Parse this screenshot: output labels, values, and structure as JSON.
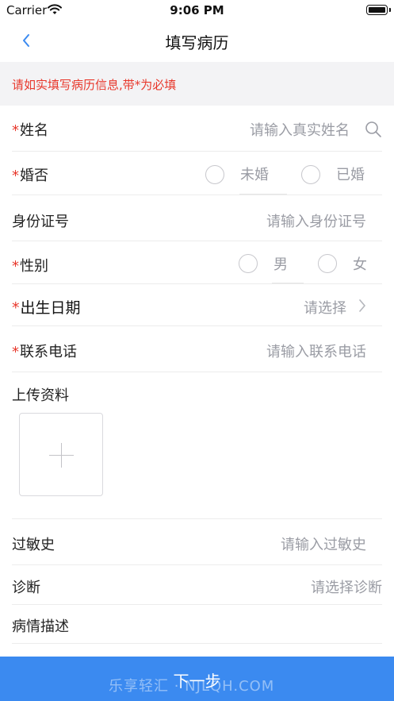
{
  "status_bar": {
    "carrier": "Carrier",
    "time": "9:06 PM"
  },
  "nav": {
    "title": "填写病历"
  },
  "notice": {
    "text": "请如实填写病历信息,带*为必填"
  },
  "form": {
    "required_mark": "*",
    "name": {
      "label": "姓名",
      "placeholder": "请输入真实姓名"
    },
    "marital": {
      "label": "婚否",
      "options": [
        "未婚",
        "已婚"
      ]
    },
    "id_number": {
      "label": "身份证号",
      "placeholder": "请输入身份证号"
    },
    "gender": {
      "label": "性别",
      "options": [
        "男",
        "女"
      ]
    },
    "birthdate": {
      "label": "出生日期",
      "placeholder": "请选择"
    },
    "phone": {
      "label": "联系电话",
      "placeholder": "请输入联系电话"
    },
    "upload": {
      "label": "上传资料"
    },
    "allergy": {
      "label": "过敏史",
      "placeholder": "请输入过敏史"
    },
    "diagnosis": {
      "label": "诊断",
      "placeholder": "请选择诊断"
    },
    "description": {
      "label": "病情描述"
    }
  },
  "footer": {
    "next_label": "下一步",
    "watermark": "乐享轻汇 · NJLQH.COM"
  },
  "colors": {
    "accent": "#3b8af0",
    "required": "#e8382c",
    "placeholder": "#9a9ca4",
    "notice_bg": "#f3f3f5"
  }
}
